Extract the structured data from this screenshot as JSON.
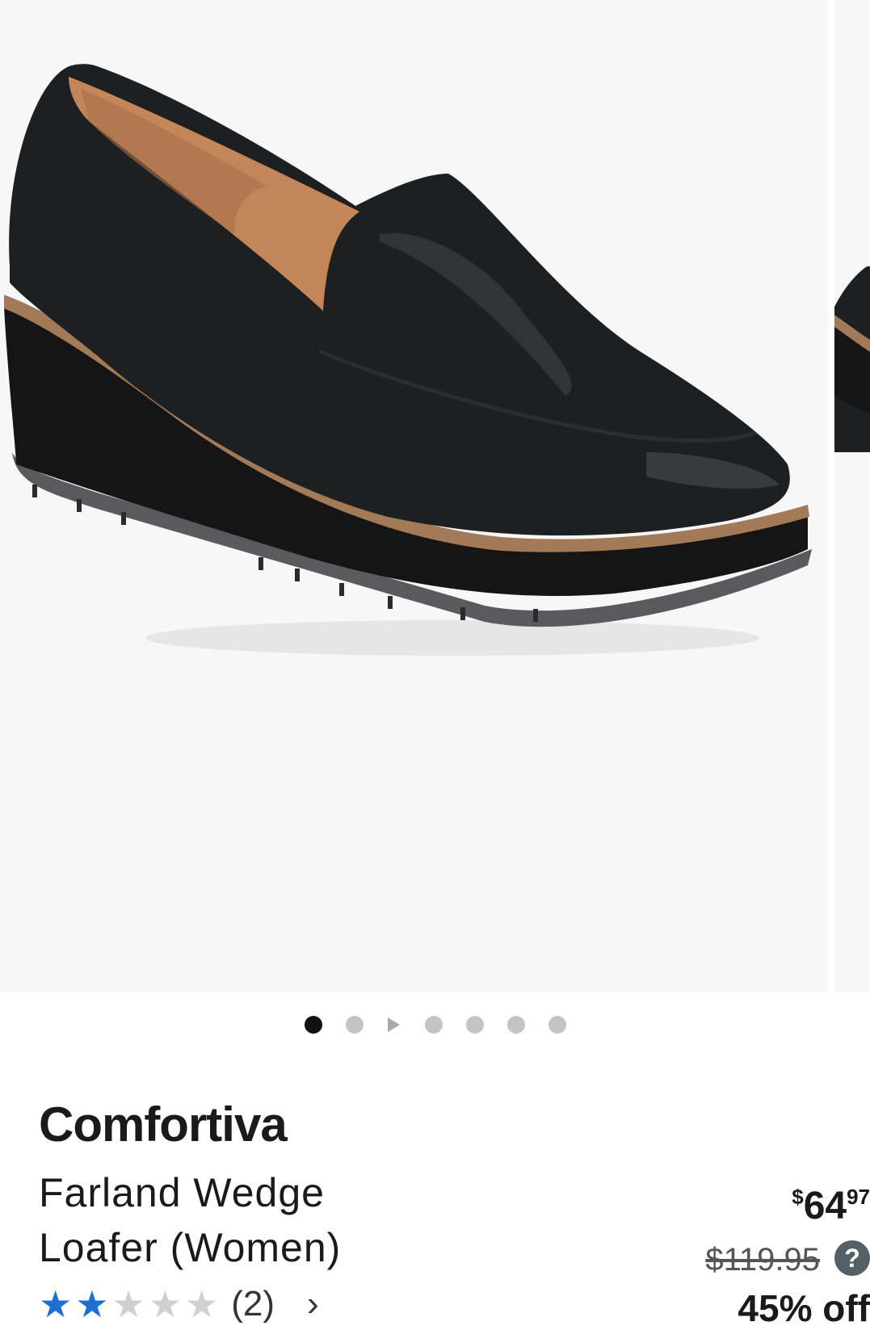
{
  "gallery": {
    "page_count": 7,
    "active_index": 0,
    "video_index": 2,
    "image_subject": "shoe-image"
  },
  "product": {
    "brand": "Comfortiva",
    "title": "Farland Wedge Loafer (Women)",
    "price_currency": "$",
    "price_whole": "64",
    "price_cents": "97",
    "price_was": "$119.95",
    "help_label": "?",
    "discount": "45% off",
    "rating": {
      "stars_filled": 2,
      "stars_total": 5,
      "review_count": "(2)",
      "chevron": "›"
    }
  },
  "colors": {
    "accent_star": "#1f6fd1",
    "image_bg": "#f7f7f7"
  }
}
